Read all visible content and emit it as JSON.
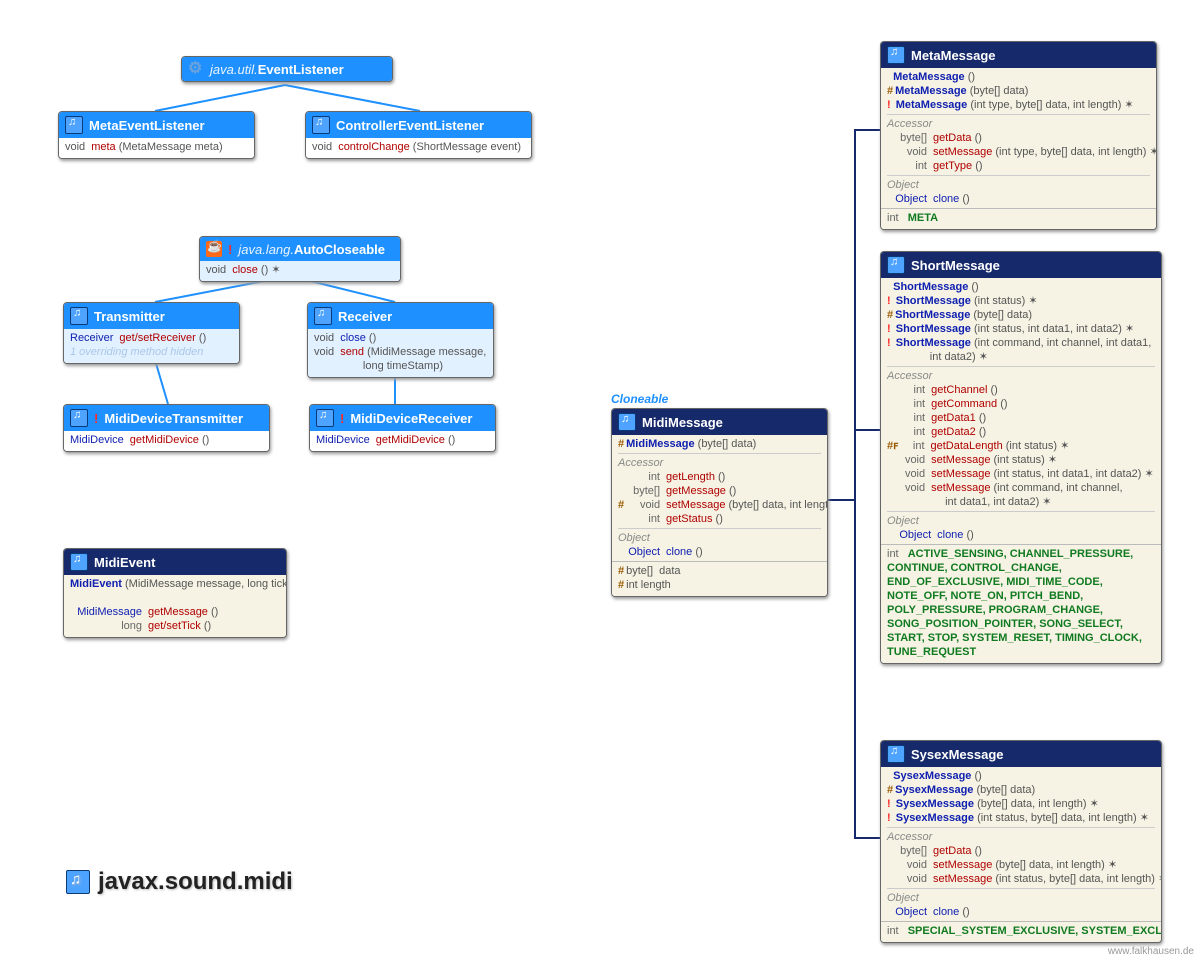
{
  "package": "javax.sound.midi",
  "watermark": "www.falkhausen.de",
  "cloneable_label": "Cloneable",
  "eventListener": {
    "prefix": "java.util.",
    "name": "EventListener"
  },
  "metaEventListener": {
    "name": "MetaEventListener",
    "m1_rt": "void",
    "m1_name": "meta",
    "m1_args": " (MetaMessage meta)"
  },
  "controllerEventListener": {
    "name": "ControllerEventListener",
    "m1_rt": "void",
    "m1_name": "controlChange",
    "m1_args": " (ShortMessage event)"
  },
  "autoCloseable": {
    "prefix": "java.lang.",
    "name": "AutoCloseable",
    "m1_rt": "void",
    "m1_name": "close",
    "m1_args": " () ✶"
  },
  "transmitter": {
    "name": "Transmitter",
    "m1_rt": "Receiver",
    "m1_name": "get/setReceiver",
    "m1_args": " ()",
    "hidden": "1 overriding method hidden"
  },
  "receiver": {
    "name": "Receiver",
    "m1_rt": "void",
    "m1_name": "close",
    "m1_args": " ()",
    "m2_rt": "void",
    "m2_name": "send",
    "m2_args": " (MidiMessage message,\n                long timeStamp)"
  },
  "midiDeviceTransmitter": {
    "name": "MidiDeviceTransmitter",
    "m1_rt": "MidiDevice",
    "m1_name": "getMidiDevice",
    "m1_args": " ()"
  },
  "midiDeviceReceiver": {
    "name": "MidiDeviceReceiver",
    "m1_rt": "MidiDevice",
    "m1_name": "getMidiDevice",
    "m1_args": " ()"
  },
  "midiEvent": {
    "name": "MidiEvent",
    "c1": "MidiEvent",
    "c1_args": " (MidiMessage message, long tick)",
    "m1_rt": "MidiMessage",
    "m1_name": "getMessage",
    "m1_args": " ()",
    "m2_rt": "long",
    "m2_name": "get/setTick",
    "m2_args": " ()"
  },
  "midiMessage": {
    "name": "MidiMessage",
    "c1": "MidiMessage",
    "c1_args": " (byte[] data)",
    "acc_label": "Accessor",
    "a1_rt": "int",
    "a1": "getLength",
    "a1_args": " ()",
    "a2_rt": "byte[]",
    "a2": "getMessage",
    "a2_args": " ()",
    "a3_rt": "void",
    "a3": "setMessage",
    "a3_args": " (byte[] data, int length) ✶",
    "a4_rt": "int",
    "a4": "getStatus",
    "a4_args": " ()",
    "obj_label": "Object",
    "o1_rt": "Object",
    "o1": "clone",
    "o1_args": " ()",
    "f1": "byte[]  data",
    "f2": "int length"
  },
  "metaMessage": {
    "name": "MetaMessage",
    "c1": "MetaMessage",
    "c1_args": " ()",
    "c2": "MetaMessage",
    "c2_args": " (byte[] data)",
    "c3": "MetaMessage",
    "c3_args": " (int type, byte[] data, int length) ✶",
    "acc_label": "Accessor",
    "a1_rt": "byte[]",
    "a1": "getData",
    "a1_args": " ()",
    "a2_rt": "void",
    "a2": "setMessage",
    "a2_args": " (int type, byte[] data, int length) ✶",
    "a3_rt": "int",
    "a3": "getType",
    "a3_args": " ()",
    "obj_label": "Object",
    "o1_rt": "Object",
    "o1": "clone",
    "o1_args": " ()",
    "const_rt": "int",
    "consts": "META"
  },
  "shortMessage": {
    "name": "ShortMessage",
    "c1": "ShortMessage",
    "c1_args": " ()",
    "c2": "ShortMessage",
    "c2_args": " (int status) ✶",
    "c3": "ShortMessage",
    "c3_args": " (byte[] data)",
    "c4": "ShortMessage",
    "c4_args": " (int status, int data1, int data2) ✶",
    "c5": "ShortMessage",
    "c5_args": " (int command, int channel, int data1,\n              int data2) ✶",
    "acc_label": "Accessor",
    "a1_rt": "int",
    "a1": "getChannel",
    "a1_args": " ()",
    "a2_rt": "int",
    "a2": "getCommand",
    "a2_args": " ()",
    "a3_rt": "int",
    "a3": "getData1",
    "a3_args": " ()",
    "a4_rt": "int",
    "a4": "getData2",
    "a4_args": " ()",
    "a5_rt": "int",
    "a5": "getDataLength",
    "a5_args": " (int status) ✶",
    "a6_rt": "void",
    "a6": "setMessage",
    "a6_args": " (int status) ✶",
    "a7_rt": "void",
    "a7": "setMessage",
    "a7_args": " (int status, int data1, int data2) ✶",
    "a8_rt": "void",
    "a8": "setMessage",
    "a8_args": " (int command, int channel,\n                   int data1, int data2) ✶",
    "obj_label": "Object",
    "o1_rt": "Object",
    "o1": "clone",
    "o1_args": " ()",
    "const_rt": "int",
    "consts": "ACTIVE_SENSING, CHANNEL_PRESSURE,\nCONTINUE, CONTROL_CHANGE,\nEND_OF_EXCLUSIVE, MIDI_TIME_CODE,\nNOTE_OFF, NOTE_ON, PITCH_BEND,\nPOLY_PRESSURE, PROGRAM_CHANGE,\nSONG_POSITION_POINTER, SONG_SELECT,\nSTART, STOP, SYSTEM_RESET, TIMING_CLOCK,\nTUNE_REQUEST"
  },
  "sysexMessage": {
    "name": "SysexMessage",
    "c1": "SysexMessage",
    "c1_args": " ()",
    "c2": "SysexMessage",
    "c2_args": " (byte[] data)",
    "c3": "SysexMessage",
    "c3_args": " (byte[] data, int length) ✶",
    "c4": "SysexMessage",
    "c4_args": " (int status, byte[] data, int length) ✶",
    "acc_label": "Accessor",
    "a1_rt": "byte[]",
    "a1": "getData",
    "a1_args": " ()",
    "a2_rt": "void",
    "a2": "setMessage",
    "a2_args": " (byte[] data, int length) ✶",
    "a3_rt": "void",
    "a3": "setMessage",
    "a3_args": " (int status, byte[] data, int length) ✶",
    "obj_label": "Object",
    "o1_rt": "Object",
    "o1": "clone",
    "o1_args": " ()",
    "const_rt": "int",
    "consts": "SPECIAL_SYSTEM_EXCLUSIVE, SYSTEM_EXCLUSIVE"
  }
}
